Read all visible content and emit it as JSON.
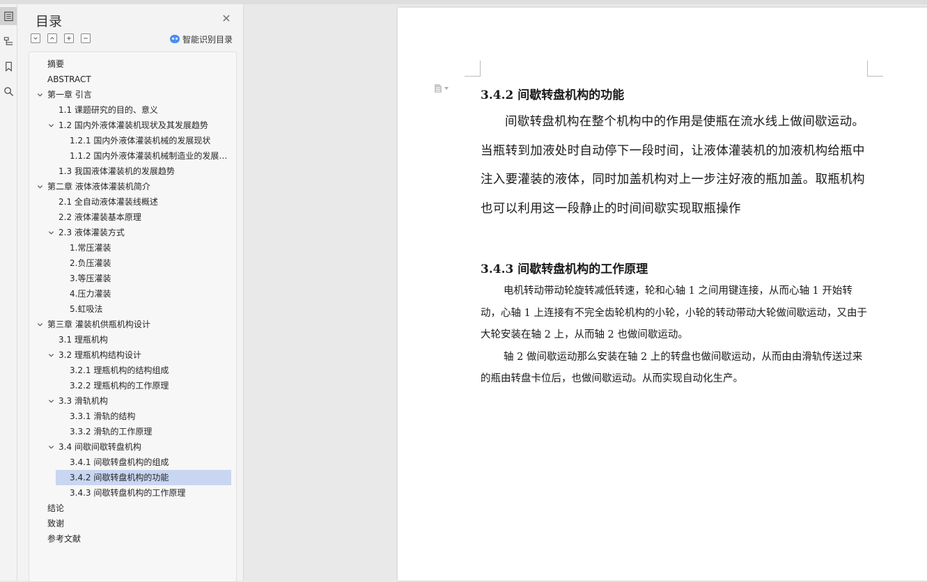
{
  "rail": {
    "icons": [
      "toc-icon",
      "nav-pane-icon",
      "bookmark-icon",
      "search-icon"
    ]
  },
  "toc": {
    "title": "目录",
    "smart_label": "智能识别目录",
    "items": [
      {
        "label": "摘要",
        "level": 0,
        "expander": false
      },
      {
        "label": "ABSTRACT",
        "level": 0,
        "expander": false
      },
      {
        "label": "第一章 引言",
        "level": 0,
        "expander": true
      },
      {
        "label": "1.1 课题研究的目的、意义",
        "level": 1,
        "expander": false
      },
      {
        "label": "1.2 国内外液体灌装机现状及其发展趋势",
        "level": 1,
        "expander": true
      },
      {
        "label": "1.2.1 国内外液体灌装机械的发展现状",
        "level": 2,
        "expander": false
      },
      {
        "label": "1.1.2 国内外液体灌装机械制造业的发展 ...",
        "level": 2,
        "expander": false
      },
      {
        "label": "1.3 我国液体灌装机的发展趋势",
        "level": 1,
        "expander": false
      },
      {
        "label": "第二章  液体液体灌装机简介",
        "level": 0,
        "expander": true
      },
      {
        "label": "2.1 全自动液体灌装线概述",
        "level": 1,
        "expander": false
      },
      {
        "label": "2.2  液体灌装基本原理",
        "level": 1,
        "expander": false
      },
      {
        "label": "2.3 液体灌装方式",
        "level": 1,
        "expander": true
      },
      {
        "label": "1.常压灌装",
        "level": 2,
        "expander": false
      },
      {
        "label": "2.负压灌装",
        "level": 2,
        "expander": false
      },
      {
        "label": "3.等压灌装",
        "level": 2,
        "expander": false
      },
      {
        "label": "4.压力灌装",
        "level": 2,
        "expander": false
      },
      {
        "label": "5.虹吸法",
        "level": 2,
        "expander": false
      },
      {
        "label": "第三章  灌装机供瓶机构设计",
        "level": 0,
        "expander": true
      },
      {
        "label": "3.1 理瓶机构",
        "level": 1,
        "expander": false
      },
      {
        "label": "3.2 理瓶机构结构设计",
        "level": 1,
        "expander": true
      },
      {
        "label": "3.2.1 理瓶机构的结构组成",
        "level": 2,
        "expander": false
      },
      {
        "label": "3.2.2 理瓶机构的工作原理",
        "level": 2,
        "expander": false
      },
      {
        "label": "3.3 滑轨机构",
        "level": 1,
        "expander": true
      },
      {
        "label": "3.3.1  滑轨的结构",
        "level": 2,
        "expander": false
      },
      {
        "label": "3.3.2 滑轨的工作原理",
        "level": 2,
        "expander": false
      },
      {
        "label": "3.4  间歇间歇转盘机构",
        "level": 1,
        "expander": true
      },
      {
        "label": "3.4.1  间歇转盘机构的组成",
        "level": 2,
        "expander": false
      },
      {
        "label": "3.4.2  间歇转盘机构的功能",
        "level": 2,
        "expander": false,
        "selected": true
      },
      {
        "label": "3.4.3  间歇转盘机构的工作原理",
        "level": 2,
        "expander": false
      },
      {
        "label": "结论",
        "level": 0,
        "expander": false
      },
      {
        "label": "致谢",
        "level": 0,
        "expander": false
      },
      {
        "label": "参考文献",
        "level": 0,
        "expander": false
      }
    ]
  },
  "doc": {
    "heading1": "3.4.2  间歇转盘机构的功能",
    "paragraph1": "间歇转盘机构在整个机构中的作用是使瓶在流水线上做间歇运动。当瓶转到加液处时自动停下一段时间，让液体灌装机的加液机构给瓶中注入要灌装的液体，同时加盖机构对上一步注好液的瓶加盖。取瓶机构也可以利用这一段静止的时间间歇实现取瓶操作",
    "heading2": "3.4.3  间歇转盘机构的工作原理",
    "paragraph2": "电机转动带动轮旋转减低转速，轮和心轴 1 之间用键连接，从而心轴 1 开始转动，心轴 1 上连接有不完全齿轮机构的小轮，小轮的转动带动大轮做间歇运动，又由于大轮安装在轴 2 上，从而轴 2 也做间歇运动。",
    "paragraph3": "轴 2 做间歇运动那么安装在轴 2 上的转盘也做间歇运动，从而由由滑轨传送过来的瓶由转盘卡位后，也做间歇运动。从而实现自动化生产。"
  }
}
